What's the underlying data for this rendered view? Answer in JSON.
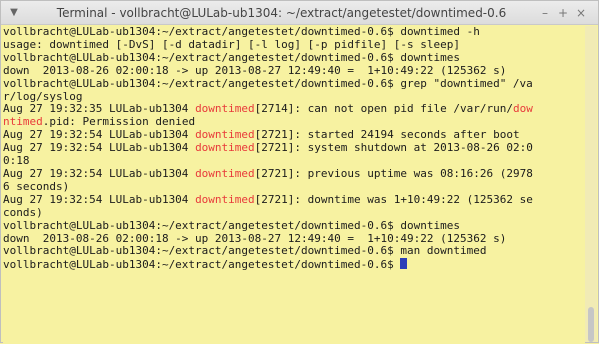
{
  "window": {
    "title": "Terminal - vollbracht@LULab-ub1304: ~/extract/angetestet/downtimed-0.6",
    "menu_icon": "chevron-down-icon",
    "controls": [
      "minimize",
      "maximize",
      "close"
    ],
    "control_glyphs": [
      "–",
      "+",
      "×"
    ]
  },
  "terminal": {
    "bg": "#f7f2a1",
    "highlight_color": "#e83a3a",
    "cursor_color": "#2c3fb8",
    "lines": [
      {
        "parts": [
          {
            "t": "vollbracht@LULab-ub1304:~/extract/angetestet/downtimed-0.6$ downtimed -h"
          }
        ]
      },
      {
        "parts": [
          {
            "t": "usage: downtimed [-DvS] [-d datadir] [-l log] [-p pidfile] [-s sleep]"
          }
        ]
      },
      {
        "parts": [
          {
            "t": "vollbracht@LULab-ub1304:~/extract/angetestet/downtimed-0.6$ downtimes"
          }
        ]
      },
      {
        "parts": [
          {
            "t": "down  2013-08-26 02:00:18 -> up 2013-08-27 12:49:40 =  1+10:49:22 (125362 s)"
          }
        ]
      },
      {
        "parts": [
          {
            "t": "vollbracht@LULab-ub1304:~/extract/angetestet/downtimed-0.6$ grep \"downtimed\" /va"
          }
        ]
      },
      {
        "parts": [
          {
            "t": "r/log/syslog"
          }
        ]
      },
      {
        "parts": [
          {
            "t": "Aug 27 19:32:35 LULab-ub1304 "
          },
          {
            "t": "downtimed",
            "hl": true
          },
          {
            "t": "[2714]: can not open pid file /var/run/"
          },
          {
            "t": "dow",
            "hl": true
          }
        ]
      },
      {
        "parts": [
          {
            "t": "ntimed",
            "hl": true
          },
          {
            "t": ".pid: Permission denied"
          }
        ]
      },
      {
        "parts": [
          {
            "t": "Aug 27 19:32:54 LULab-ub1304 "
          },
          {
            "t": "downtimed",
            "hl": true
          },
          {
            "t": "[2721]: started 24194 seconds after boot"
          }
        ]
      },
      {
        "parts": [
          {
            "t": "Aug 27 19:32:54 LULab-ub1304 "
          },
          {
            "t": "downtimed",
            "hl": true
          },
          {
            "t": "[2721]: system shutdown at 2013-08-26 02:0"
          }
        ]
      },
      {
        "parts": [
          {
            "t": "0:18"
          }
        ]
      },
      {
        "parts": [
          {
            "t": "Aug 27 19:32:54 LULab-ub1304 "
          },
          {
            "t": "downtimed",
            "hl": true
          },
          {
            "t": "[2721]: previous uptime was 08:16:26 (2978"
          }
        ]
      },
      {
        "parts": [
          {
            "t": "6 seconds)"
          }
        ]
      },
      {
        "parts": [
          {
            "t": "Aug 27 19:32:54 LULab-ub1304 "
          },
          {
            "t": "downtimed",
            "hl": true
          },
          {
            "t": "[2721]: downtime was 1+10:49:22 (125362 se"
          }
        ]
      },
      {
        "parts": [
          {
            "t": "conds)"
          }
        ]
      },
      {
        "parts": [
          {
            "t": "vollbracht@LULab-ub1304:~/extract/angetestet/downtimed-0.6$ downtimes"
          }
        ]
      },
      {
        "parts": [
          {
            "t": "down  2013-08-26 02:00:18 -> up 2013-08-27 12:49:40 =  1+10:49:22 (125362 s)"
          }
        ]
      },
      {
        "parts": [
          {
            "t": "vollbracht@LULab-ub1304:~/extract/angetestet/downtimed-0.6$ man downtimed"
          }
        ]
      },
      {
        "parts": [
          {
            "t": "vollbracht@LULab-ub1304:~/extract/angetestet/downtimed-0.6$ "
          }
        ],
        "cursor": true
      }
    ]
  },
  "scrollbar": {
    "thumb_start_fraction": 0.89,
    "thumb_length_fraction": 0.11
  }
}
